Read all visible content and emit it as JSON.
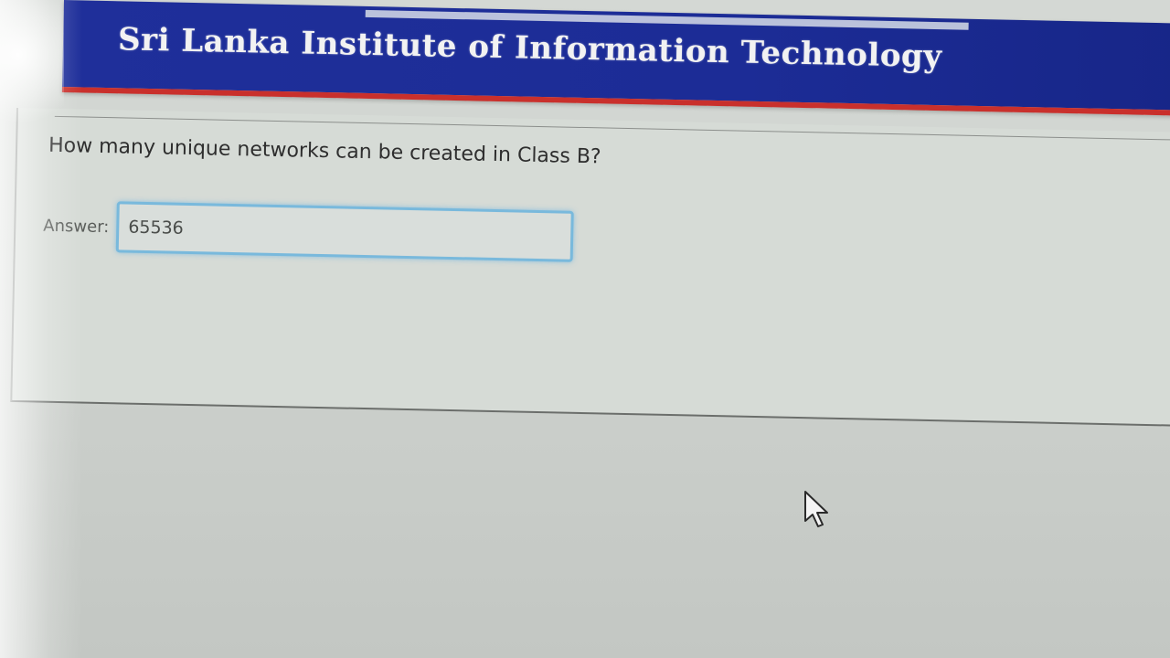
{
  "header": {
    "title": "Sri Lanka Institute of Information Technology"
  },
  "question": {
    "text": "How many unique networks can be created in Class B?",
    "answer_label": "Answer:",
    "answer_value": "65536"
  },
  "colors": {
    "banner_blue": "#1f2f9a",
    "banner_red": "#c9302c",
    "input_focus": "#79b9dc"
  },
  "icons": {
    "cursor": "mouse-pointer-icon"
  }
}
